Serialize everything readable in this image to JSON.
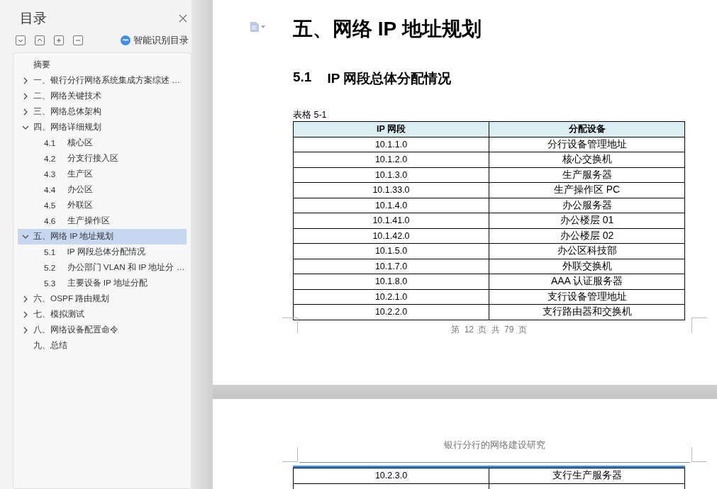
{
  "toc": {
    "title": "目录",
    "smart_button": "智能识别目录",
    "items": [
      {
        "kind": "leaf",
        "label": "摘要",
        "selected": false
      },
      {
        "kind": "section",
        "label": "一、银行分行网络系统集成方案综述 …",
        "expanded": false,
        "selected": false
      },
      {
        "kind": "section",
        "label": "二、网络关键技术",
        "expanded": false,
        "selected": false
      },
      {
        "kind": "section",
        "label": "三、网络总体架构",
        "expanded": false,
        "selected": false
      },
      {
        "kind": "section",
        "label": "四、网络详细规划",
        "expanded": true,
        "selected": false,
        "children": [
          {
            "number": "4.1",
            "title": "核心区"
          },
          {
            "number": "4.2",
            "title": "分支行接入区"
          },
          {
            "number": "4.3",
            "title": "生产区"
          },
          {
            "number": "4.4",
            "title": "办公区"
          },
          {
            "number": "4.5",
            "title": "外联区"
          },
          {
            "number": "4.6",
            "title": "生产操作区"
          }
        ]
      },
      {
        "kind": "section",
        "label": "五、网络 IP 地址规划",
        "expanded": true,
        "selected": true,
        "children": [
          {
            "number": "5.1",
            "title": "IP 网段总体分配情况"
          },
          {
            "number": "5.2",
            "title": "办公部门 VLAN 和 IP 地址分 …"
          },
          {
            "number": "5.3",
            "title": "主要设备 IP 地址分配"
          }
        ]
      },
      {
        "kind": "section",
        "label": "六、OSPF 路由规划",
        "expanded": false,
        "selected": false
      },
      {
        "kind": "section",
        "label": "七、模拟测试",
        "expanded": false,
        "selected": false
      },
      {
        "kind": "section",
        "label": "八、网络设备配置命令",
        "expanded": false,
        "selected": false
      },
      {
        "kind": "leaf",
        "label": "九、总结",
        "selected": false
      }
    ]
  },
  "page_1": {
    "heading": "五、网络 IP 地址规划",
    "subheading": {
      "number": "5.1",
      "title": "IP 网段总体分配情况"
    },
    "caption": "表格 5-1",
    "table": {
      "columns": [
        "IP 网段",
        "分配设备"
      ],
      "rows": [
        [
          "10.1.1.0",
          "分行设备管理地址"
        ],
        [
          "10.1.2.0",
          "核心交换机"
        ],
        [
          "10.1.3.0",
          "生产服务器"
        ],
        [
          "10.1.33.0",
          "生产操作区 PC"
        ],
        [
          "10.1.4.0",
          "办公服务器"
        ],
        [
          "10.1.41.0",
          "办公楼层 01"
        ],
        [
          "10.1.42.0",
          "办公楼层 02"
        ],
        [
          "10.1.5.0",
          "办公区科技部"
        ],
        [
          "10.1.7.0",
          "外联交换机"
        ],
        [
          "10.1.8.0",
          "AAA 认证服务器"
        ],
        [
          "10.2.1.0",
          "支行设备管理地址"
        ],
        [
          "10.2.2.0",
          "支行路由器和交换机"
        ]
      ]
    },
    "footer": "第 12 页 共 79 页"
  },
  "page_2": {
    "header": "银行分行的网络建设研究",
    "table": {
      "rows": [
        [
          "10.2.3.0",
          "支行生产服务器"
        ]
      ]
    }
  }
}
